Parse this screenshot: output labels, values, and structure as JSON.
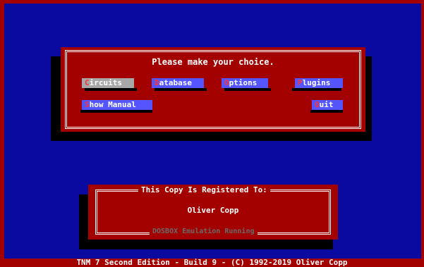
{
  "menu": {
    "prompt": "Please make your choice.",
    "buttons": {
      "circuits": {
        "hot": "C",
        "rest": "ircuits"
      },
      "database": {
        "hot": "D",
        "rest": "atabase"
      },
      "options": {
        "hot": "O",
        "rest": "ptions"
      },
      "plugins": {
        "hot": "P",
        "rest": "lugins"
      },
      "show_manual": {
        "hot": "S",
        "rest": "how Manual"
      },
      "quit": {
        "hot": "Q",
        "rest": "uit"
      }
    }
  },
  "registration": {
    "legend": "This Copy Is Registered To:",
    "name": "Oliver Copp",
    "footer": "DOSBOX Emulation Running"
  },
  "status_bar": "TNM 7 Second Edition - Build 9 - (C) 1992-2019 Oliver Copp",
  "colors": {
    "background": "#0a0aa0",
    "dialog": "#a30000",
    "button": "#5555ff",
    "button_selected": "#a8a8a8",
    "hotkey": "#ff3333"
  }
}
